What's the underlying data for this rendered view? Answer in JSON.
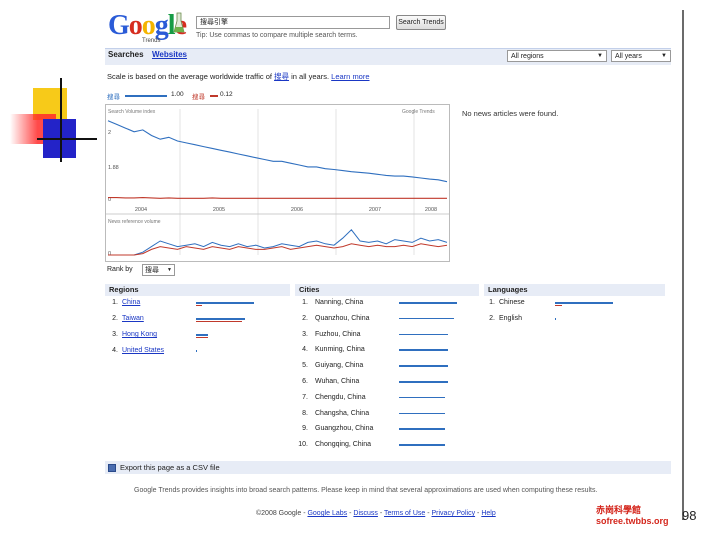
{
  "page_number": "98",
  "logo": {
    "letters": [
      "G",
      "o",
      "o",
      "g",
      "l",
      "e"
    ],
    "colors": [
      "#2a5bd7",
      "#d62d20",
      "#f4b400",
      "#2a5bd7",
      "#169b45",
      "#d62d20"
    ],
    "sub": "Trends"
  },
  "search": {
    "value": "搜尋引擎",
    "button": "Search Trends",
    "tip": "Tip: Use commas to compare multiple search terms."
  },
  "tabs": {
    "searches": "Searches",
    "websites": "Websites"
  },
  "filters": {
    "region": "All regions",
    "years": "All years"
  },
  "scale": {
    "text": "Scale is based on the average worldwide traffic of ",
    "term": "搜尋",
    "suffix": " in all years.",
    "learn_more": "Learn more"
  },
  "legend": [
    {
      "term": "搜尋",
      "value": "1.00",
      "color": "#2f6fbf"
    },
    {
      "term": "搜尋",
      "value": "0.12",
      "color": "#c0392b"
    }
  ],
  "news": "No news articles were found.",
  "rank_by": {
    "label": "Rank by",
    "value": "搜尋"
  },
  "chart_data": {
    "type": "line",
    "title": "",
    "panels": [
      {
        "name": "Search Volume index",
        "source": "Google Trends",
        "y_ticks": [
          "2",
          "1.88",
          "0"
        ],
        "x_ticks": [
          "2004",
          "2005",
          "2006",
          "2007",
          "2008"
        ],
        "series": [
          {
            "color": "#2f6fbf",
            "values": [
              2.2,
              2.1,
              2.0,
              1.9,
              1.95,
              1.8,
              1.7,
              1.75,
              1.65,
              1.6,
              1.55,
              1.5,
              1.45,
              1.4,
              1.35,
              1.3,
              1.25,
              1.2,
              1.15,
              1.1,
              1.1,
              1.05,
              1.0,
              0.95,
              0.95,
              0.9,
              0.88,
              0.85,
              0.82,
              0.8,
              0.78,
              0.75,
              0.72,
              0.7,
              0.7,
              0.68,
              0.65,
              0.62,
              0.6,
              0.55
            ]
          },
          {
            "color": "#c0392b",
            "values": [
              0.12,
              0.12,
              0.11,
              0.11,
              0.12,
              0.11,
              0.1,
              0.11,
              0.1,
              0.1,
              0.1,
              0.1,
              0.11,
              0.1,
              0.1,
              0.1,
              0.1,
              0.1,
              0.1,
              0.1,
              0.1,
              0.1,
              0.1,
              0.1,
              0.1,
              0.1,
              0.1,
              0.1,
              0.1,
              0.1,
              0.1,
              0.1,
              0.1,
              0.1,
              0.1,
              0.1,
              0.1,
              0.1,
              0.1,
              0.1
            ]
          }
        ]
      },
      {
        "name": "News reference volume",
        "y_ticks": [
          "0"
        ],
        "series": [
          {
            "color": "#2f6fbf",
            "values": [
              0,
              0,
              0,
              0,
              0.1,
              0.3,
              0.5,
              0.4,
              0.3,
              0.35,
              0.4,
              0.3,
              0.45,
              0.35,
              0.3,
              0.4,
              0.3,
              0.35,
              0.25,
              0.3,
              0.4,
              0.35,
              0.3,
              0.45,
              0.5,
              0.4,
              0.35,
              0.6,
              0.9,
              0.5,
              0.45,
              0.5,
              0.4,
              0.55,
              0.5,
              0.45,
              0.6,
              0.5,
              0.55,
              0.45
            ]
          },
          {
            "color": "#c0392b",
            "values": [
              0,
              0,
              0,
              0,
              0.05,
              0.2,
              0.3,
              0.25,
              0.2,
              0.3,
              0.25,
              0.2,
              0.3,
              0.25,
              0.2,
              0.3,
              0.25,
              0.2,
              0.2,
              0.25,
              0.3,
              0.2,
              0.25,
              0.3,
              0.35,
              0.3,
              0.25,
              0.3,
              0.4,
              0.35,
              0.3,
              0.35,
              0.3,
              0.3,
              0.35,
              0.3,
              0.4,
              0.35,
              0.3,
              0.35
            ]
          }
        ]
      }
    ]
  },
  "regions": {
    "title": "Regions",
    "rows": [
      {
        "rank": "1.",
        "name": "China",
        "blue": 1.0,
        "red": 0.1
      },
      {
        "rank": "2.",
        "name": "Taiwan",
        "blue": 0.85,
        "red": 0.8
      },
      {
        "rank": "3.",
        "name": "Hong Kong",
        "blue": 0.2,
        "red": 0.2
      },
      {
        "rank": "4.",
        "name": "United States",
        "blue": 0.02,
        "red": 0.0
      }
    ]
  },
  "cities": {
    "title": "Cities",
    "rows": [
      {
        "rank": "1.",
        "name": "Nanning, China",
        "blue": 1.0
      },
      {
        "rank": "2.",
        "name": "Quanzhou, China",
        "blue": 0.95
      },
      {
        "rank": "3.",
        "name": "Fuzhou, China",
        "blue": 0.85
      },
      {
        "rank": "4.",
        "name": "Kunming, China",
        "blue": 0.85
      },
      {
        "rank": "5.",
        "name": "Guiyang, China",
        "blue": 0.85
      },
      {
        "rank": "6.",
        "name": "Wuhan, China",
        "blue": 0.85
      },
      {
        "rank": "7.",
        "name": "Chengdu, China",
        "blue": 0.8
      },
      {
        "rank": "8.",
        "name": "Changsha, China",
        "blue": 0.8
      },
      {
        "rank": "9.",
        "name": "Guangzhou, China",
        "blue": 0.8
      },
      {
        "rank": "10.",
        "name": "Chongqing, China",
        "blue": 0.8
      }
    ]
  },
  "languages": {
    "title": "Languages",
    "rows": [
      {
        "rank": "1.",
        "name": "Chinese",
        "blue": 1.0,
        "red": 0.12
      },
      {
        "rank": "2.",
        "name": "English",
        "blue": 0.01,
        "red": 0.0
      }
    ]
  },
  "csv": "Export this page as a CSV file",
  "footer_text": "Google Trends provides insights into broad search patterns. Please keep in mind that several approximations are used when computing these results.",
  "footer_links": {
    "copyright": "©2008 Google - ",
    "labs": "Google Labs",
    "discuss": "Discuss",
    "terms": "Terms of Use",
    "privacy": "Privacy Policy",
    "help": "Help",
    "sep": " - "
  },
  "watermark": [
    "赤崗科學館",
    "sofree.twbbs.org"
  ],
  "colors": {
    "blue": "#2f6fbf",
    "red": "#c0392b",
    "accent": "#e7ecf6"
  }
}
